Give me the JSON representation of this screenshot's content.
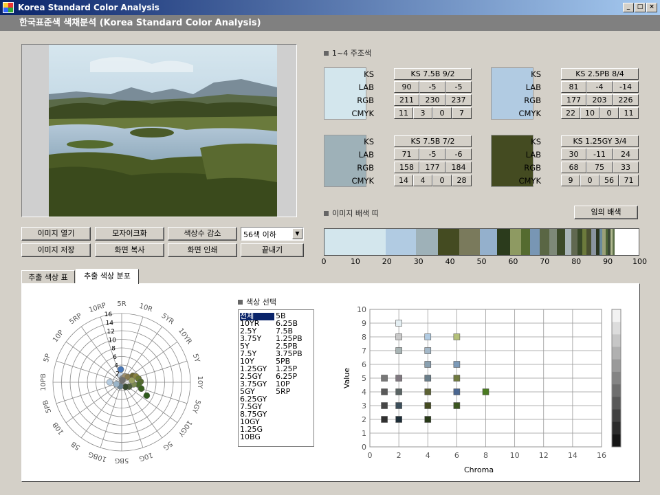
{
  "window": {
    "title": "Korea Standard Color Analysis"
  },
  "app_header": {
    "title": "한국표준색 색채분석 (Korea Standard Color Analysis)"
  },
  "colors": {
    "titlebar": "#0a246a",
    "selection": "#0a246a",
    "panel": "#d4d0c8",
    "header": "#808080"
  },
  "buttons": {
    "open": "이미지 열기",
    "mosaic": "모자이크화",
    "reduce": "색상수 감소",
    "save": "이미지 저장",
    "copy": "화면 복사",
    "print": "화면 인쇄",
    "exit": "끝내기",
    "random": "임의 배색"
  },
  "color_count_select": {
    "value": "56색 이하"
  },
  "main_colors": {
    "label": "1~4 주조색",
    "field_labels": {
      "ks": "KS",
      "lab": "LAB",
      "rgb": "RGB",
      "cmyk": "CMYK"
    },
    "items": [
      {
        "swatch": "#d3e6ed",
        "ks": "KS 7.5B 9/2",
        "lab": [
          "90",
          "-5",
          "-5"
        ],
        "rgb": [
          "211",
          "230",
          "237"
        ],
        "cmyk": [
          "11",
          "3",
          "0",
          "7"
        ]
      },
      {
        "swatch": "#b1cbe2",
        "ks": "KS 2.5PB 8/4",
        "lab": [
          "81",
          "-4",
          "-14"
        ],
        "rgb": [
          "177",
          "203",
          "226"
        ],
        "cmyk": [
          "22",
          "10",
          "0",
          "11"
        ]
      },
      {
        "swatch": "#9eb1b8",
        "ks": "KS 7.5B 7/2",
        "lab": [
          "71",
          "-5",
          "-6"
        ],
        "rgb": [
          "158",
          "177",
          "184"
        ],
        "cmyk": [
          "14",
          "4",
          "0",
          "28"
        ]
      },
      {
        "swatch": "#444b21",
        "ks": "KS 1.25GY 3/4",
        "lab": [
          "30",
          "-11",
          "24"
        ],
        "rgb": [
          "68",
          "75",
          "33"
        ],
        "cmyk": [
          "9",
          "0",
          "56",
          "71"
        ]
      }
    ]
  },
  "palette_strip": {
    "label": "이미지 배색 띠",
    "segments": [
      {
        "color": "#d3e6ed",
        "pct": 19.5
      },
      {
        "color": "#b1cbe2",
        "pct": 9.5
      },
      {
        "color": "#9eb1b8",
        "pct": 7.0
      },
      {
        "color": "#444b21",
        "pct": 7.0
      },
      {
        "color": "#7a7a5c",
        "pct": 6.5
      },
      {
        "color": "#94b0cc",
        "pct": 5.5
      },
      {
        "color": "#2b3b1c",
        "pct": 4.0
      },
      {
        "color": "#8e9a62",
        "pct": 3.5
      },
      {
        "color": "#556b2f",
        "pct": 3.0
      },
      {
        "color": "#7896b4",
        "pct": 3.0
      },
      {
        "color": "#5a6644",
        "pct": 3.0
      },
      {
        "color": "#7d8878",
        "pct": 2.5
      },
      {
        "color": "#3c4a2a",
        "pct": 2.5
      },
      {
        "color": "#a8b4b8",
        "pct": 2.0
      },
      {
        "color": "#606850",
        "pct": 2.0
      },
      {
        "color": "#384828",
        "pct": 1.5
      },
      {
        "color": "#6c7a3c",
        "pct": 1.5
      },
      {
        "color": "#4a5030",
        "pct": 1.5
      },
      {
        "color": "#8a94a0",
        "pct": 1.5
      },
      {
        "color": "#2a3420",
        "pct": 1.0
      },
      {
        "color": "#6a8a9c",
        "pct": 1.0
      },
      {
        "color": "#9aa078",
        "pct": 1.0
      },
      {
        "color": "#4c6438",
        "pct": 0.8
      },
      {
        "color": "#3a4834",
        "pct": 0.8
      },
      {
        "color": "#b0b890",
        "pct": 0.7
      },
      {
        "color": "#5c7048",
        "pct": 0.7
      }
    ],
    "ticks": [
      "0",
      "10",
      "20",
      "30",
      "40",
      "50",
      "60",
      "70",
      "80",
      "90",
      "100"
    ]
  },
  "tabs": {
    "table": "추출 색상 표",
    "distribution": "추출 색상 분포"
  },
  "polar_chart": {
    "hue_labels": [
      "5R",
      "10R",
      "5YR",
      "10YR",
      "5Y",
      "10Y",
      "5GY",
      "10GY",
      "5G",
      "10G",
      "5BG",
      "10BG",
      "5B",
      "10B",
      "5PB",
      "10PB",
      "5P",
      "10P",
      "5RP",
      "10RP"
    ],
    "radial_labels": [
      "2",
      "4",
      "6",
      "8",
      "10",
      "12",
      "14",
      "16"
    ]
  },
  "color_select": {
    "label": "색상 선택",
    "col1": [
      "전체",
      "10YR",
      "2.5Y",
      "3.75Y",
      "5Y",
      "7.5Y",
      "10Y",
      "1.25GY",
      "2.5GY",
      "3.75GY",
      "5GY",
      "6.25GY",
      "7.5GY",
      "8.75GY",
      "10GY",
      "1.25G",
      "10BG"
    ],
    "col2": [
      "5B",
      "6.25B",
      "7.5B",
      "1.25PB",
      "2.5PB",
      "3.75PB",
      "5PB",
      "1.25P",
      "6.25P",
      "10P",
      "5RP"
    ]
  },
  "chart_data": {
    "type": "scatter",
    "xlabel": "Chroma",
    "ylabel": "Value",
    "xlim": [
      0,
      16
    ],
    "ylim": [
      0,
      10
    ],
    "x_ticks": [
      "0",
      "2",
      "4",
      "6",
      "8",
      "10",
      "12",
      "14",
      "16"
    ],
    "y_ticks": [
      "0",
      "1",
      "2",
      "3",
      "4",
      "5",
      "6",
      "7",
      "8",
      "9",
      "10"
    ],
    "points": [
      {
        "x": 2,
        "y": 9,
        "color": "#e4eef2"
      },
      {
        "x": 2,
        "y": 8,
        "color": "#c8c8c8"
      },
      {
        "x": 4,
        "y": 8,
        "color": "#b1cbe2"
      },
      {
        "x": 6,
        "y": 8,
        "color": "#b4c07a"
      },
      {
        "x": 2,
        "y": 7,
        "color": "#a8b4b4"
      },
      {
        "x": 4,
        "y": 7,
        "color": "#a4b8c8"
      },
      {
        "x": 4,
        "y": 6,
        "color": "#8aa0b0"
      },
      {
        "x": 6,
        "y": 6,
        "color": "#7c9ab8"
      },
      {
        "x": 1,
        "y": 5,
        "color": "#787878"
      },
      {
        "x": 2,
        "y": 5,
        "color": "#807880"
      },
      {
        "x": 4,
        "y": 5,
        "color": "#6a7e8a"
      },
      {
        "x": 6,
        "y": 5,
        "color": "#707a40"
      },
      {
        "x": 1,
        "y": 4,
        "color": "#5a5a5a"
      },
      {
        "x": 2,
        "y": 4,
        "color": "#5a6464"
      },
      {
        "x": 4,
        "y": 4,
        "color": "#5c6234"
      },
      {
        "x": 6,
        "y": 4,
        "color": "#4a6690"
      },
      {
        "x": 8,
        "y": 4,
        "color": "#4a7a20"
      },
      {
        "x": 1,
        "y": 3,
        "color": "#464646"
      },
      {
        "x": 2,
        "y": 3,
        "color": "#3c4e5a"
      },
      {
        "x": 4,
        "y": 3,
        "color": "#444b21"
      },
      {
        "x": 6,
        "y": 3,
        "color": "#3c5620"
      },
      {
        "x": 1,
        "y": 2,
        "color": "#303030"
      },
      {
        "x": 2,
        "y": 2,
        "color": "#1e2e38"
      },
      {
        "x": 4,
        "y": 2,
        "color": "#283a18"
      }
    ],
    "legend_ramp": [
      "#f2f2f2",
      "#dcdcdc",
      "#c6c6c6",
      "#b0b0b0",
      "#9a9a9a",
      "#848484",
      "#6e6e6e",
      "#585858",
      "#424242",
      "#2c2c2c",
      "#161616"
    ]
  },
  "polar_points": [
    {
      "hue": 356,
      "r": 3.0,
      "color": "#4a78b8"
    },
    {
      "hue": 352,
      "r": 1.6,
      "color": "#c8d8e8"
    },
    {
      "hue": 10,
      "r": 0.9,
      "color": "#8a8a8a"
    },
    {
      "hue": 30,
      "r": 1.6,
      "color": "#a09070"
    },
    {
      "hue": 50,
      "r": 1.9,
      "color": "#887a50"
    },
    {
      "hue": 60,
      "r": 3.0,
      "color": "#6a6630"
    },
    {
      "hue": 68,
      "r": 3.6,
      "color": "#8a8440"
    },
    {
      "hue": 78,
      "r": 4.0,
      "color": "#6a7830"
    },
    {
      "hue": 88,
      "r": 4.4,
      "color": "#556b2f"
    },
    {
      "hue": 98,
      "r": 4.0,
      "color": "#4a6a28"
    },
    {
      "hue": 108,
      "r": 4.8,
      "color": "#3a6020"
    },
    {
      "hue": 118,
      "r": 6.6,
      "color": "#2e5a1c"
    },
    {
      "hue": 100,
      "r": 2.8,
      "color": "#7a8a50"
    },
    {
      "hue": 80,
      "r": 2.4,
      "color": "#9aa060"
    },
    {
      "hue": 120,
      "r": 2.0,
      "color": "#506040"
    },
    {
      "hue": 140,
      "r": 1.4,
      "color": "#384a30"
    },
    {
      "hue": 200,
      "r": 1.0,
      "color": "#6a8090"
    },
    {
      "hue": 250,
      "r": 1.3,
      "color": "#9ab4c8"
    },
    {
      "hue": 270,
      "r": 2.8,
      "color": "#b6cce0"
    },
    {
      "hue": 20,
      "r": 0.5,
      "color": "#707070"
    }
  ]
}
